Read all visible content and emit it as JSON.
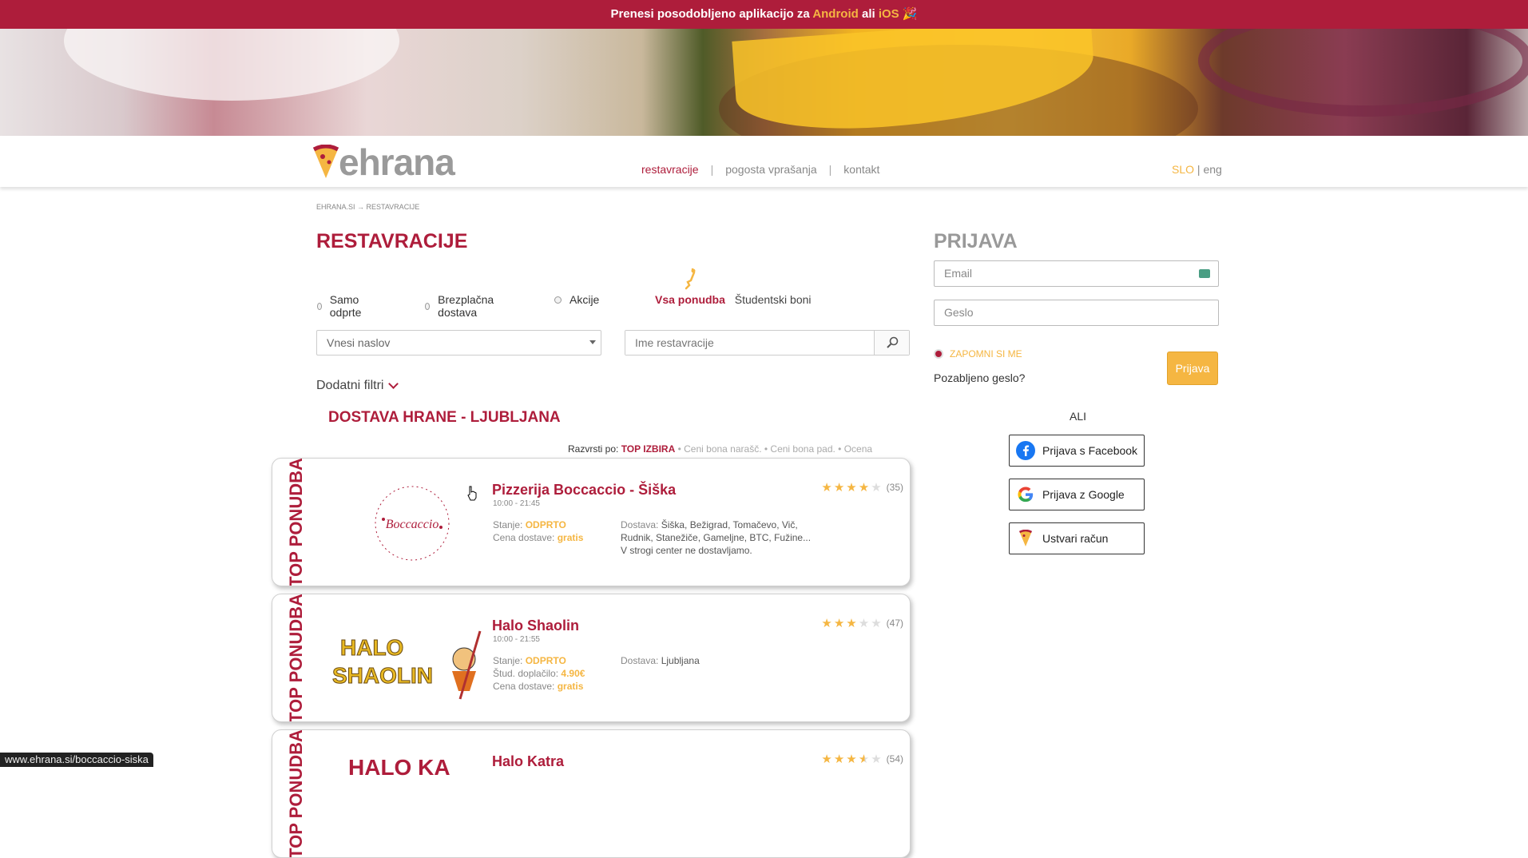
{
  "promo": {
    "before": "Prenesi posodobljeno aplikacijo za ",
    "android": "Android",
    "mid": " ali ",
    "ios": "iOS",
    "emoji": "🎉"
  },
  "logo": {
    "text": "ehrana"
  },
  "nav": {
    "items": [
      "restavracije",
      "pogosta vprašanja",
      "kontakt"
    ]
  },
  "lang": {
    "current": "SLO",
    "sep": " | ",
    "other": "eng"
  },
  "breadcrumb": "EHRANA.SI → RESTAVRACIJE",
  "title": "RESTAVRACIJE",
  "filters": {
    "open_only": "Samo odprte",
    "free_delivery": "Brezplačna dostava",
    "promos": "Akcije"
  },
  "tabs": {
    "all": "Vsa ponudba",
    "student": "Študentski boni"
  },
  "address_select": {
    "value": "Vnesi naslov"
  },
  "search": {
    "placeholder": "Ime restavracije"
  },
  "more_filters": "Dodatni filtri",
  "city_heading": "DOSTAVA HRANE - LJUBLJANA",
  "sort": {
    "label": "Razvrsti po: ",
    "active": "TOP IZBIRA",
    "o1": "Ceni bona narašč.",
    "o2": "Ceni bona pad.",
    "o3": "Ocena",
    "bullet": " • "
  },
  "restaurants": [
    {
      "badge": "TOP PONUDBA",
      "name": "Pizzerija Boccaccio - Šiška",
      "hours": "10:00 - 21:45",
      "state_label": "Stanje: ",
      "state": "ODPRTO",
      "fee_label": "Cena dostave: ",
      "fee": "gratis",
      "delivery_label": "Dostava: ",
      "delivery": "Šiška, Bežigrad, Tomačevo, Vič, Rudnik, Stanežiče, Gameljne, BTC, Fužine... V strogi center ne dostavljamo.",
      "rating": 4,
      "reviews": "(35)",
      "logo_text": "Boccaccio"
    },
    {
      "badge": "TOP PONUDBA",
      "name": "Halo Shaolin",
      "hours": "10:00 - 21:55",
      "state_label": "Stanje: ",
      "state": "ODPRTO",
      "extra_label": "Štud. doplačilo: ",
      "extra": "4.90€",
      "fee_label": "Cena dostave: ",
      "fee": "gratis",
      "delivery_label": "Dostava: ",
      "delivery": "Ljubljana",
      "rating": 3,
      "reviews": "(47)",
      "logo_text": "HALO SHAOLIN"
    },
    {
      "badge": "TOP PONUDBA",
      "name": "Halo Katra",
      "rating": 3.5,
      "reviews": "(54)",
      "logo_text": "HALO KA"
    }
  ],
  "login": {
    "title": "PRIJAVA",
    "email_placeholder": "Email",
    "password_placeholder": "Geslo",
    "remember": "ZAPOMNI SI ME",
    "forgot": "Pozabljeno geslo?",
    "submit": "Prijava",
    "or": "ALI",
    "facebook": "Prijava s Facebook",
    "google": "Prijava z Google",
    "register": "Ustvari račun"
  },
  "statusbar": "www.ehrana.si/boccaccio-siska",
  "colors": {
    "brand": "#ae1d3b",
    "accent": "#f5b642"
  }
}
